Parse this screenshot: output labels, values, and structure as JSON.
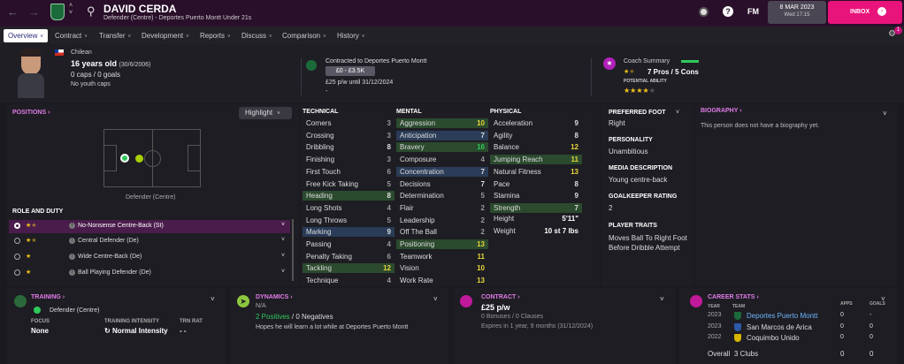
{
  "header": {
    "player_name": "DAVID CERDA",
    "subtitle": "Defender (Centre) - Deportes Puerto Montt Under 21s",
    "fm": "FM",
    "date": "8 MAR 2023",
    "time": "Wed 17:15",
    "inbox": "INBOX",
    "notif_count": "1"
  },
  "nav": {
    "tabs": [
      {
        "label": "Overview"
      },
      {
        "label": "Contract"
      },
      {
        "label": "Transfer"
      },
      {
        "label": "Development"
      },
      {
        "label": "Reports"
      },
      {
        "label": "Discuss"
      },
      {
        "label": "Comparison"
      },
      {
        "label": "History"
      }
    ]
  },
  "info": {
    "nationality": "Chilean",
    "age": "16 years old",
    "dob": "(30/6/2006)",
    "caps": "0 caps / 0 goals",
    "youth_caps": "No youth caps",
    "contracted": "Contracted to Deportes Puerto Montt",
    "value": "£0 - £3.5K",
    "wage": "£25 p/w until 31/12/2024",
    "dash": "-",
    "coach_summary": "Coach Summary",
    "coach_stars": 1.5,
    "pros_cons": "7 Pros / 5 Cons",
    "potential_label": "POTENTIAL ABILITY",
    "potential_stars": 4
  },
  "positions": {
    "title": "POSITIONS",
    "highlight": "Highlight",
    "position_label": "Defender (Centre)",
    "role_title": "ROLE AND DUTY",
    "roles": [
      {
        "name": "No-Nonsense Centre-Back (St)",
        "stars": 1.5,
        "selected": true
      },
      {
        "name": "Central Defender (De)",
        "stars": 1.5,
        "selected": false
      },
      {
        "name": "Wide Centre-Back (De)",
        "stars": 1,
        "selected": false
      },
      {
        "name": "Ball Playing Defender (De)",
        "stars": 1,
        "selected": false
      }
    ]
  },
  "technical": {
    "title": "TECHNICAL",
    "rows": [
      {
        "n": "Corners",
        "v": "3"
      },
      {
        "n": "Crossing",
        "v": "3"
      },
      {
        "n": "Dribbling",
        "v": "8"
      },
      {
        "n": "Finishing",
        "v": "3"
      },
      {
        "n": "First Touch",
        "v": "6"
      },
      {
        "n": "Free Kick Taking",
        "v": "5"
      },
      {
        "n": "Heading",
        "v": "8"
      },
      {
        "n": "Long Shots",
        "v": "4"
      },
      {
        "n": "Long Throws",
        "v": "5"
      },
      {
        "n": "Marking",
        "v": "9"
      },
      {
        "n": "Passing",
        "v": "4"
      },
      {
        "n": "Penalty Taking",
        "v": "6"
      },
      {
        "n": "Tackling",
        "v": "12"
      },
      {
        "n": "Technique",
        "v": "4"
      }
    ]
  },
  "mental": {
    "title": "MENTAL",
    "rows": [
      {
        "n": "Aggression",
        "v": "10"
      },
      {
        "n": "Anticipation",
        "v": "7"
      },
      {
        "n": "Bravery",
        "v": "16"
      },
      {
        "n": "Composure",
        "v": "4"
      },
      {
        "n": "Concentration",
        "v": "7"
      },
      {
        "n": "Decisions",
        "v": "7"
      },
      {
        "n": "Determination",
        "v": "5"
      },
      {
        "n": "Flair",
        "v": "2"
      },
      {
        "n": "Leadership",
        "v": "2"
      },
      {
        "n": "Off The Ball",
        "v": "2"
      },
      {
        "n": "Positioning",
        "v": "13"
      },
      {
        "n": "Teamwork",
        "v": "11"
      },
      {
        "n": "Vision",
        "v": "10"
      },
      {
        "n": "Work Rate",
        "v": "13"
      }
    ]
  },
  "physical": {
    "title": "PHYSICAL",
    "rows": [
      {
        "n": "Acceleration",
        "v": "9"
      },
      {
        "n": "Agility",
        "v": "8"
      },
      {
        "n": "Balance",
        "v": "12"
      },
      {
        "n": "Jumping Reach",
        "v": "11"
      },
      {
        "n": "Natural Fitness",
        "v": "13"
      },
      {
        "n": "Pace",
        "v": "8"
      },
      {
        "n": "Stamina",
        "v": "9"
      },
      {
        "n": "Strength",
        "v": "7"
      }
    ],
    "height_label": "Height",
    "height": "5'11\"",
    "weight_label": "Weight",
    "weight": "10 st 7 lbs"
  },
  "details": {
    "foot_title": "PREFERRED FOOT",
    "foot": "Right",
    "personality_title": "PERSONALITY",
    "personality": "Unambitious",
    "media_title": "MEDIA DESCRIPTION",
    "media": "Young centre-back",
    "gk_title": "GOALKEEPER RATING",
    "gk": "2",
    "traits_title": "PLAYER TRAITS",
    "traits": [
      "Moves Ball To Right Foot",
      "Before Dribble Attempt"
    ]
  },
  "bio": {
    "title": "BIOGRAPHY",
    "text": "This person does not have a biography yet."
  },
  "training": {
    "title": "TRAINING",
    "position": "Defender (Centre)",
    "focus_label": "FOCUS",
    "focus": "None",
    "intensity_label": "TRAINING INTENSITY",
    "intensity": "Normal Intensity",
    "trn_label": "TRN RAT",
    "trn": "- -"
  },
  "dynamics": {
    "title": "DYNAMICS",
    "status": "N/A",
    "positives": "2 Positives",
    "negatives": "0 Negatives",
    "note": "Hopes he will learn a lot while at Deportes Puerto Montt"
  },
  "contract": {
    "title": "CONTRACT",
    "wage": "£25 p/w",
    "bonuses": "0 Bonuses / 0 Clauses",
    "expires": "Expires in 1 year, 9 months (31/12/2024)"
  },
  "career": {
    "title": "CAREER STATS",
    "h_year": "YEAR",
    "h_team": "TEAM",
    "h_apps": "APPS",
    "h_goals": "GOALS",
    "rows": [
      {
        "year": "2023",
        "team": "Deportes Puerto Montt",
        "apps": "0",
        "goals": "-"
      },
      {
        "year": "2023",
        "team": "San Marcos de Arica",
        "apps": "0",
        "goals": "0"
      },
      {
        "year": "2022",
        "team": "Coquimbo Unido",
        "apps": "0",
        "goals": "0"
      }
    ],
    "overall_label": "Overall",
    "overall_clubs": "3 Clubs",
    "overall_apps": "0",
    "overall_goals": "0"
  },
  "colors": {
    "accent": "#e07ce8",
    "topbar": "#2a0f2b",
    "inbox": "#e8137b",
    "star": "#f5c518"
  }
}
